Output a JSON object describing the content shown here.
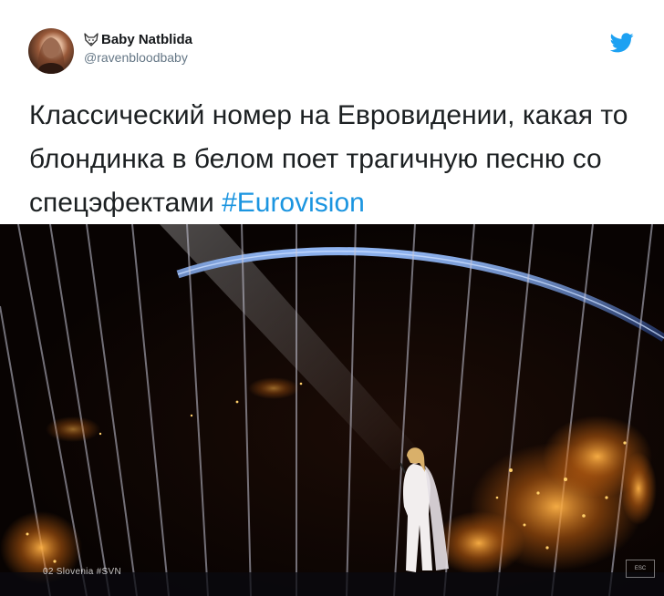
{
  "tweet": {
    "author_name": "Baby Natblida",
    "author_handle": "@ravenbloodbaby",
    "text": "Классический номер на Евровидении, какая то блондинка в белом поет трагичную песню со спецэфектами ",
    "hashtag": "#Eurovision"
  },
  "media": {
    "caption": "02 Slovenia #SVN"
  },
  "colors": {
    "hashtag": "#1b95e0",
    "twitter_blue": "#1da1f2",
    "handle": "#657786"
  },
  "icons": [
    "fox-emoji-icon",
    "twitter-bird-icon"
  ]
}
